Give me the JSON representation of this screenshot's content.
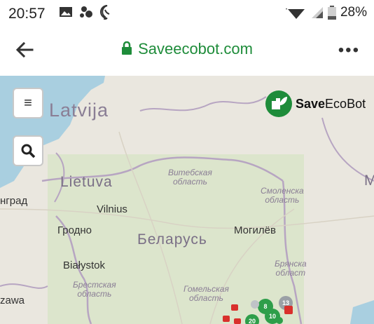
{
  "status_bar": {
    "time": "20:57",
    "battery": "28%"
  },
  "address_bar": {
    "url": "Saveecobot.com",
    "more": "•••"
  },
  "map_controls": {
    "menu_glyph": "≡"
  },
  "logo": {
    "text_bold": "Save",
    "text_rest": "EcoBot"
  },
  "map_labels": {
    "latvija": "Latvija",
    "lietuva": "Lietuva",
    "vilnius": "Vilnius",
    "ngrad": "нград",
    "grodno": "Гродно",
    "belarus": "Беларусь",
    "mogilev": "Могилёв",
    "bialystok": "Białystok",
    "zawa": "zawa",
    "vitebsk_line1": "Витебская",
    "vitebsk_line2": "область",
    "smolensk_line1": "Смоленска",
    "smolensk_line2": "область",
    "bryansk_line1": "Брянска",
    "bryansk_line2": "област",
    "brest_line1": "Брестская",
    "brest_line2": "область",
    "gomel_line1": "Гомельская",
    "gomel_line2": "область",
    "m_edge": "M"
  },
  "markers": [
    {
      "label": "8",
      "color": "#2e9e4a"
    },
    {
      "label": "10",
      "color": "#2e9e4a"
    },
    {
      "label": "20",
      "color": "#2e9e4a"
    },
    {
      "label": "13",
      "color": "#9aa0a6"
    }
  ],
  "colors": {
    "accent": "#1e8c3a",
    "marker_green": "#2e9e4a",
    "marker_red": "#d9302c",
    "water": "#a9cfe0"
  }
}
